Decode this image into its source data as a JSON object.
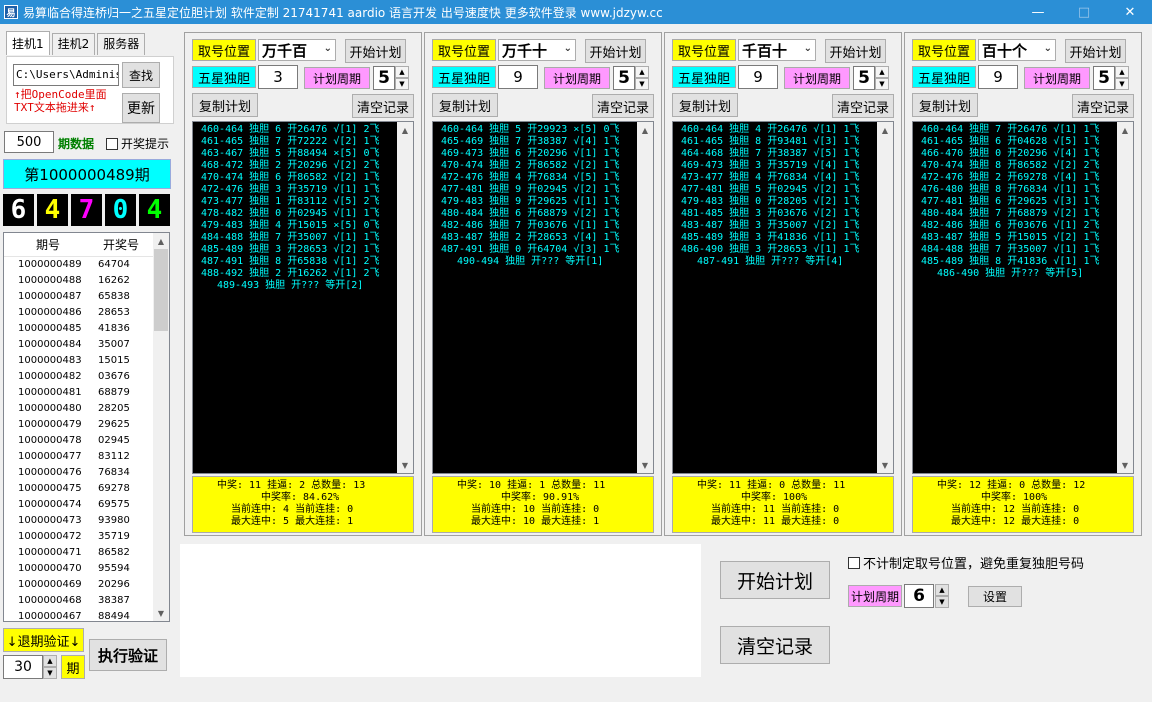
{
  "window": {
    "title": "易算临合得连桥归一之五星定位胆计划 软件定制 21741741 aardio 语言开发 出号速度快 更多软件登录 www.jdzyw.cc",
    "minimize": "—",
    "maximize": "□",
    "close": "✕",
    "app_icon": "易"
  },
  "left": {
    "tabs": [
      "挂机1",
      "挂机2",
      "服务器"
    ],
    "path_value": "C:\\Users\\Administ",
    "query_btn": "查找",
    "hint_line1": "↑把OpenCode里面",
    "hint_line2": "TXT文本拖进来↑",
    "update_btn": "更新",
    "count": "500",
    "count_label": "期数据",
    "prize_alert": "开奖提示",
    "period_title": "第1000000489期",
    "digits": [
      {
        "value": "6",
        "color": "#ffffff"
      },
      {
        "value": "4",
        "color": "#ffff00"
      },
      {
        "value": "7",
        "color": "#ff00ff"
      },
      {
        "value": "0",
        "color": "#00ffff"
      },
      {
        "value": "4",
        "color": "#00ff00"
      }
    ],
    "table": {
      "headers": [
        "期号",
        "开奖号"
      ],
      "rows": [
        [
          "1000000489",
          "64704"
        ],
        [
          "1000000488",
          "16262"
        ],
        [
          "1000000487",
          "65838"
        ],
        [
          "1000000486",
          "28653"
        ],
        [
          "1000000485",
          "41836"
        ],
        [
          "1000000484",
          "35007"
        ],
        [
          "1000000483",
          "15015"
        ],
        [
          "1000000482",
          "03676"
        ],
        [
          "1000000481",
          "68879"
        ],
        [
          "1000000480",
          "28205"
        ],
        [
          "1000000479",
          "29625"
        ],
        [
          "1000000478",
          "02945"
        ],
        [
          "1000000477",
          "83112"
        ],
        [
          "1000000476",
          "76834"
        ],
        [
          "1000000475",
          "69278"
        ],
        [
          "1000000474",
          "69575"
        ],
        [
          "1000000473",
          "93980"
        ],
        [
          "1000000472",
          "35719"
        ],
        [
          "1000000471",
          "86582"
        ],
        [
          "1000000470",
          "95594"
        ],
        [
          "1000000469",
          "20296"
        ],
        [
          "1000000468",
          "38387"
        ],
        [
          "1000000467",
          "88494"
        ]
      ]
    },
    "back_verify": "↓退期验证↓",
    "back_periods": "30",
    "period_unit": "期",
    "exec_verify": "执行验证"
  },
  "plans": [
    {
      "pos_label": "取号位置",
      "pos_value": "万千百",
      "start_btn": "开始计划",
      "single_label": "五星独胆",
      "single_value": "3",
      "cycle_label": "计划周期",
      "cycle_value": "5",
      "copy_btn": "复制计划",
      "clear_btn": "清空记录",
      "log": [
        "460-464 独胆 6 开26476 √[1] 2飞",
        "461-465 独胆 7 开72222 √[2] 1飞",
        "463-467 独胆 5 开88494 ×[5] 0飞",
        "468-472 独胆 2 开20296 √[2] 2飞",
        "470-474 独胆 6 开86582 √[2] 1飞",
        "472-476 独胆 3 开35719 √[1] 1飞",
        "473-477 独胆 1 开83112 √[5] 2飞",
        "478-482 独胆 0 开02945 √[1] 1飞",
        "479-483 独胆 4 开15015 ×[5] 0飞",
        "484-488 独胆 7 开35007 √[1] 1飞",
        "485-489 独胆 3 开28653 √[2] 1飞",
        "487-491 独胆 8 开65838 √[1] 2飞",
        "488-492 独胆 2 开16262 √[1] 2飞"
      ],
      "pending": "489-493 独胆 开??? 等开[2]",
      "stats": {
        "l1": "中奖: 11  挂逼: 2  总数量: 13",
        "l2": "中奖率: 84.62%",
        "l3": "当前连中: 4  当前连挂: 0",
        "l4": "最大连中: 5  最大连挂: 1"
      }
    },
    {
      "pos_label": "取号位置",
      "pos_value": "万千十",
      "start_btn": "开始计划",
      "single_label": "五星独胆",
      "single_value": "9",
      "cycle_label": "计划周期",
      "cycle_value": "5",
      "copy_btn": "复制计划",
      "clear_btn": "清空记录",
      "log": [
        "460-464 独胆 5 开29923 ×[5] 0飞",
        "465-469 独胆 7 开38387 √[4] 1飞",
        "469-473 独胆 6 开20296 √[1] 1飞",
        "470-474 独胆 2 开86582 √[2] 1飞",
        "472-476 独胆 4 开76834 √[5] 1飞",
        "477-481 独胆 9 开02945 √[2] 1飞",
        "479-483 独胆 9 开29625 √[1] 1飞",
        "480-484 独胆 6 开68879 √[2] 1飞",
        "482-486 独胆 7 开03676 √[1] 1飞",
        "483-487 独胆 2 开28653 √[4] 1飞",
        "487-491 独胆 0 开64704 √[3] 1飞"
      ],
      "pending": "490-494 独胆 开??? 等开[1]",
      "stats": {
        "l1": "中奖: 10  挂逼: 1  总数量: 11",
        "l2": "中奖率: 90.91%",
        "l3": "当前连中: 10  当前连挂: 0",
        "l4": "最大连中: 10  最大连挂: 1"
      }
    },
    {
      "pos_label": "取号位置",
      "pos_value": "千百十",
      "start_btn": "开始计划",
      "single_label": "五星独胆",
      "single_value": "9",
      "cycle_label": "计划周期",
      "cycle_value": "5",
      "copy_btn": "复制计划",
      "clear_btn": "清空记录",
      "log": [
        "460-464 独胆 4 开26476 √[1] 1飞",
        "461-465 独胆 8 开93481 √[3] 1飞",
        "464-468 独胆 7 开38387 √[5] 1飞",
        "469-473 独胆 3 开35719 √[4] 1飞",
        "473-477 独胆 4 开76834 √[4] 1飞",
        "477-481 独胆 5 开02945 √[2] 1飞",
        "479-483 独胆 0 开28205 √[2] 1飞",
        "481-485 独胆 3 开03676 √[2] 1飞",
        "483-487 独胆 3 开35007 √[2] 1飞",
        "485-489 独胆 3 开41836 √[1] 1飞",
        "486-490 独胆 3 开28653 √[1] 1飞"
      ],
      "pending": "487-491 独胆 开??? 等开[4]",
      "stats": {
        "l1": "中奖: 11  挂逼: 0  总数量: 11",
        "l2": "中奖率: 100%",
        "l3": "当前连中: 11  当前连挂: 0",
        "l4": "最大连中: 11  最大连挂: 0"
      }
    },
    {
      "pos_label": "取号位置",
      "pos_value": "百十个",
      "start_btn": "开始计划",
      "single_label": "五星独胆",
      "single_value": "9",
      "cycle_label": "计划周期",
      "cycle_value": "5",
      "copy_btn": "复制计划",
      "clear_btn": "清空记录",
      "log": [
        "460-464 独胆 7 开26476 √[1] 1飞",
        "461-465 独胆 6 开04628 √[5] 1飞",
        "466-470 独胆 0 开20296 √[4] 1飞",
        "470-474 独胆 8 开86582 √[2] 2飞",
        "472-476 独胆 2 开69278 √[4] 1飞",
        "476-480 独胆 8 开76834 √[1] 1飞",
        "477-481 独胆 6 开29625 √[3] 1飞",
        "480-484 独胆 7 开68879 √[2] 1飞",
        "482-486 独胆 6 开03676 √[1] 2飞",
        "483-487 独胆 5 开15015 √[2] 1飞",
        "484-488 独胆 7 开35007 √[1] 1飞",
        "485-489 独胆 8 开41836 √[1] 1飞"
      ],
      "pending": "486-490 独胆 开??? 等开[5]",
      "stats": {
        "l1": "中奖: 12  挂逼: 0  总数量: 12",
        "l2": "中奖率: 100%",
        "l3": "当前连中: 12  当前连挂: 0",
        "l4": "最大连中: 12  最大连挂: 0"
      }
    }
  ],
  "bottom": {
    "start_btn": "开始计划",
    "clear_btn": "清空记录",
    "nofix_label": "不计制定取号位置，避免重复独胆号码",
    "cycle_label": "计划周期",
    "cycle_value": "6",
    "settings_btn": "设置"
  }
}
